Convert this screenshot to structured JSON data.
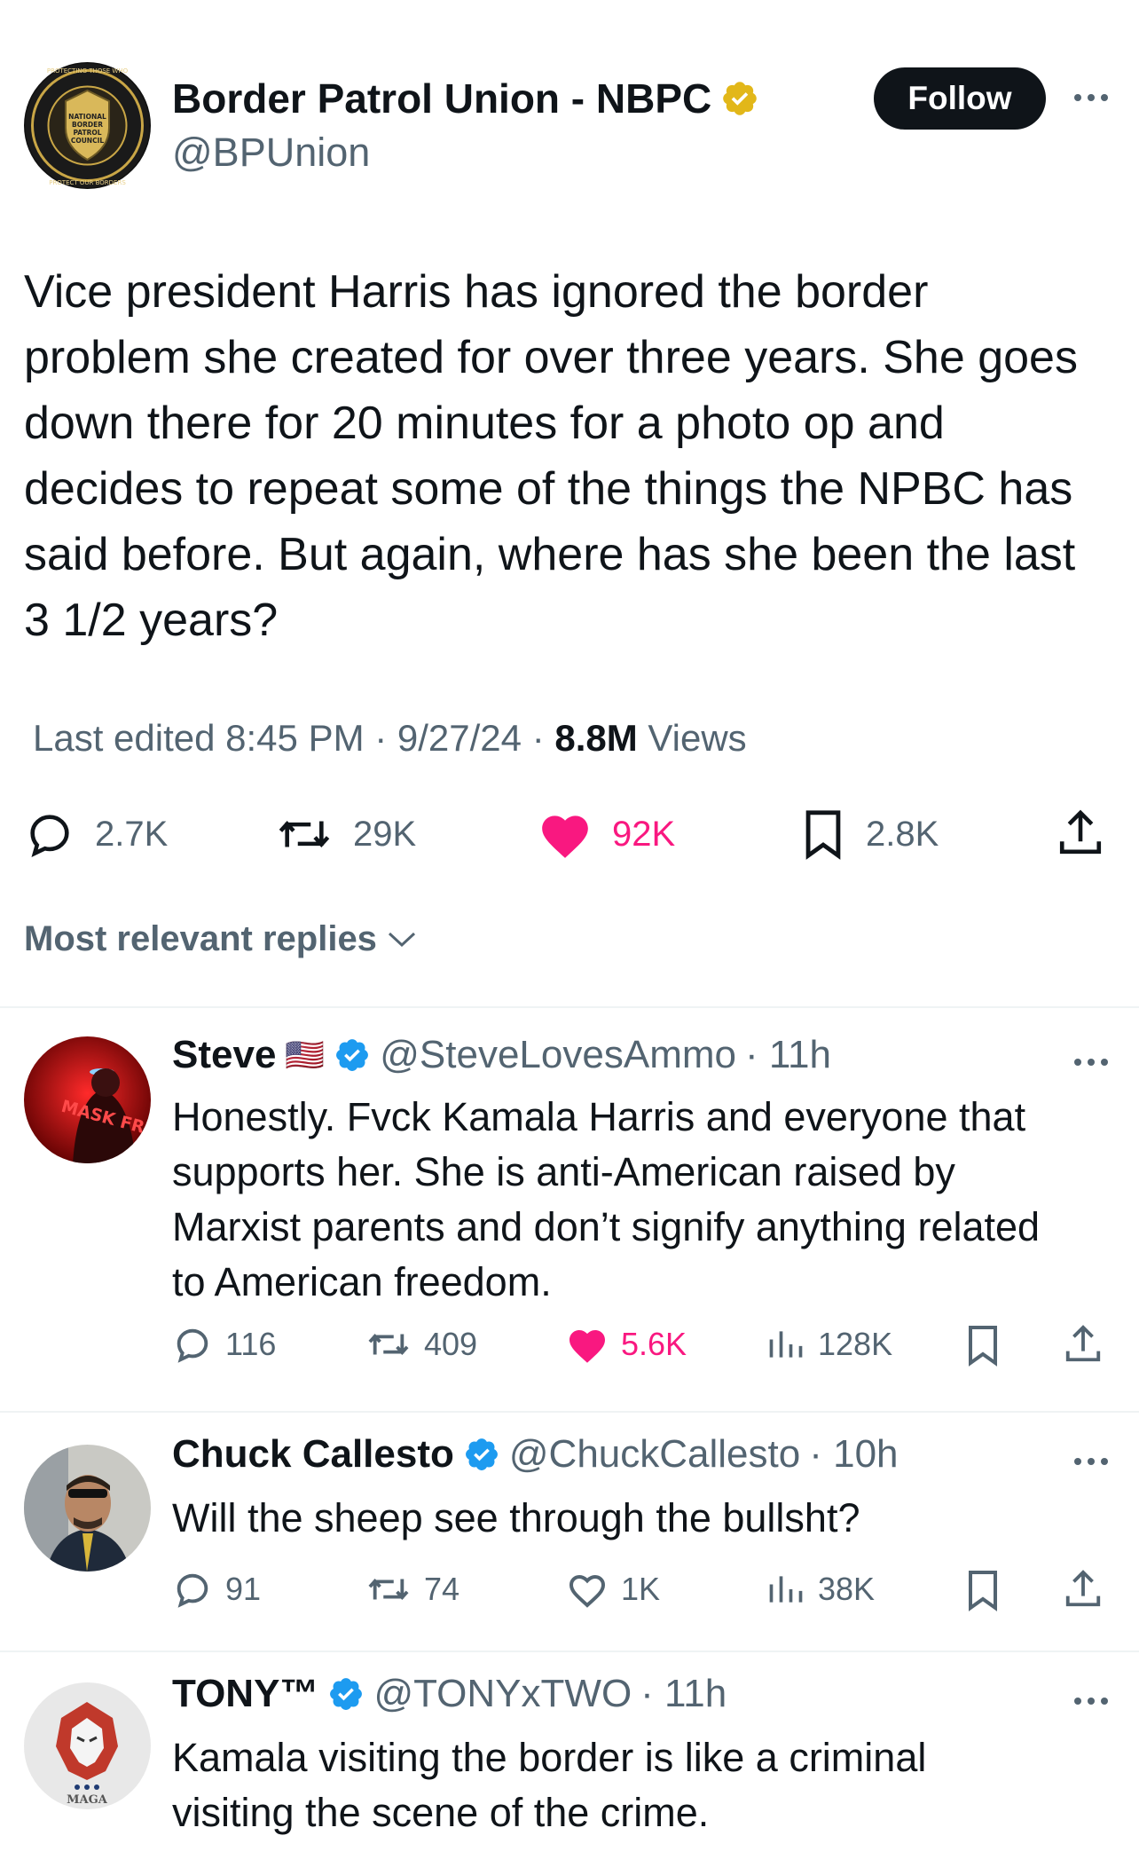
{
  "main_tweet": {
    "author_name": "Border Patrol Union - NBPC",
    "author_handle": "@BPUnion",
    "verified_badge": "gold-verified-icon",
    "follow_label": "Follow",
    "body_lines": [
      "Vice president Harris has ignored the border",
      "problem she created for over three years. She goes",
      "down there for 20 minutes for a photo op and",
      "decides to repeat some of the things the NPBC has",
      "said before. But again, where has she been the last",
      "3 1/2 years?"
    ],
    "meta_prefix": "Last edited 8:45 PM · 9/27/24  · ",
    "views_count": "8.8M",
    "views_label": " Views",
    "stats": {
      "replies": "2.7K",
      "reposts": "29K",
      "likes": "92K",
      "bookmarks": "2.8K"
    },
    "avatar_logo_text": {
      "top": "PROTECTING THOSE WHO",
      "center": [
        "NATIONAL",
        "BORDER",
        "PATROL",
        "COUNCIL"
      ],
      "bottom": "PROTECT OUR BORDERS"
    }
  },
  "replies_header": "Most relevant replies",
  "replies": [
    {
      "name": "Steve",
      "flag": "🇺🇸",
      "handle": "@SteveLovesAmmo",
      "time": "· 11h",
      "lines": [
        "Honestly. Fvck Kamala Harris and everyone that",
        "supports her. She is anti-American raised by",
        "Marxist parents and don’t signify anything related",
        "to American freedom."
      ],
      "avatar_text": "MASK FREE",
      "stats": {
        "replies": "116",
        "reposts": "409",
        "likes": "5.6K",
        "views": "128K"
      },
      "liked": true
    },
    {
      "name": "Chuck Callesto",
      "handle": "@ChuckCallesto",
      "time": "· 10h",
      "lines": [
        "Will the sheep see through the bullsht?"
      ],
      "stats": {
        "replies": "91",
        "reposts": "74",
        "likes": "1K",
        "views": "38K"
      },
      "liked": false
    },
    {
      "name": "TONY™",
      "handle": "@TONYxTWO",
      "time": "· 11h",
      "lines": [
        "Kamala visiting the border is like a criminal",
        "visiting the scene of the crime."
      ],
      "avatar_text": "MAGA"
    }
  ],
  "colors": {
    "text": "#0f1419",
    "muted": "#536471",
    "like": "#f91880",
    "verified_blue": "#1d9bf0",
    "verified_gold": "#e2b719",
    "divider": "#eff3f4"
  }
}
